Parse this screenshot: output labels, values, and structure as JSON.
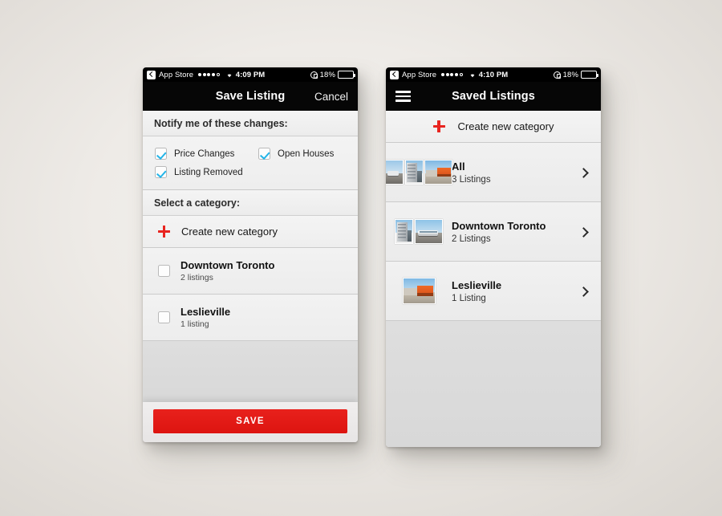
{
  "left_phone": {
    "status_bar": {
      "back_label": "App Store",
      "signal_dots_filled": 4,
      "signal_dots_total": 5,
      "wifi_icon": "wifi-icon",
      "time": "4:09 PM",
      "rotation_lock_icon": "rotation-lock-icon",
      "battery_percent": "18%",
      "battery_level": 18,
      "battery_color": "#ee2b24"
    },
    "nav": {
      "title": "Save Listing",
      "cancel_label": "Cancel"
    },
    "notify_section": {
      "header": "Notify me of these changes:",
      "options": [
        {
          "label": "Price Changes",
          "checked": true
        },
        {
          "label": "Open Houses",
          "checked": true
        },
        {
          "label": "Listing Removed",
          "checked": true
        }
      ]
    },
    "category_section": {
      "header": "Select a category:",
      "create_label": "Create new category",
      "create_icon": "plus-icon",
      "categories": [
        {
          "title": "Downtown Toronto",
          "subtitle": "2 listings",
          "checked": false
        },
        {
          "title": "Leslieville",
          "subtitle": "1 listing",
          "checked": false
        }
      ]
    },
    "save_button": {
      "label": "SAVE",
      "color": "#e8211c"
    }
  },
  "right_phone": {
    "status_bar": {
      "back_label": "App Store",
      "signal_dots_filled": 4,
      "signal_dots_total": 5,
      "wifi_icon": "wifi-icon",
      "time": "4:10 PM",
      "rotation_lock_icon": "rotation-lock-icon",
      "battery_percent": "18%",
      "battery_level": 18,
      "battery_color": "#ee2b24"
    },
    "nav": {
      "menu_icon": "hamburger-menu-icon",
      "title": "Saved Listings"
    },
    "create_label": "Create new category",
    "create_icon": "plus-icon",
    "saved_categories": [
      {
        "title": "All",
        "subtitle": "3 Listings",
        "thumb_count": 3
      },
      {
        "title": "Downtown Toronto",
        "subtitle": "2 Listings",
        "thumb_count": 2
      },
      {
        "title": "Leslieville",
        "subtitle": "1 Listing",
        "thumb_count": 1
      }
    ]
  }
}
